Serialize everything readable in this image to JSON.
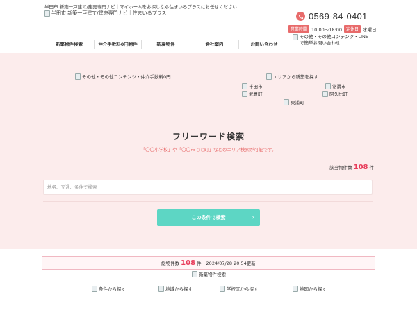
{
  "header": {
    "tagline": "半田市 新築一戸建て/建売専門ナビ｜マイホームをお探しなら住まいるプラスにお任せください！",
    "logo_alt": "半田市 新築一戸建て/建売専門ナビ｜住まいるプラス",
    "phone_icon": "phone-icon",
    "phone": "0569-84-0401",
    "hours_label": "営業時間",
    "hours": "10:00～18:00",
    "holiday_label": "定休日",
    "holiday": "水曜日",
    "line_contact_1": "その他・その他コンテンツ・LINE",
    "line_contact_2": "で簡単お問い合わせ"
  },
  "nav": {
    "items": [
      {
        "label": "新築物件検索"
      },
      {
        "label": "仲介手数料0円物件"
      },
      {
        "label": "新着物件"
      },
      {
        "label": "会社案内"
      },
      {
        "label": "お問い合わせ"
      }
    ]
  },
  "hero": {
    "banner_alt": "その他・その他コンテンツ・仲介手数料0円",
    "area_alt": "エリアから新築を探す",
    "areas": [
      "半田市",
      "常滑市",
      "武豊町",
      "阿久比町",
      "東浦町"
    ]
  },
  "search": {
    "title": "フリーワード検索",
    "hint": "「〇〇小学校」や「〇〇市 ○○町」などのエリア検索が可能です。",
    "count_label": "該当物件数",
    "count": "108",
    "count_unit": "件",
    "placeholder": "地名、交通、条件で検索",
    "button_label": "この条件で検索",
    "button_icon": "chevron-right-icon"
  },
  "update": {
    "label": "総物件数",
    "count": "108",
    "unit": "件",
    "timestamp": "2024/07/28 20:54更新"
  },
  "listings": {
    "title_alt": "新築物件検索",
    "categories": [
      "条件から探す",
      "地域から探す",
      "学校区から探す",
      "地図から探す"
    ]
  }
}
